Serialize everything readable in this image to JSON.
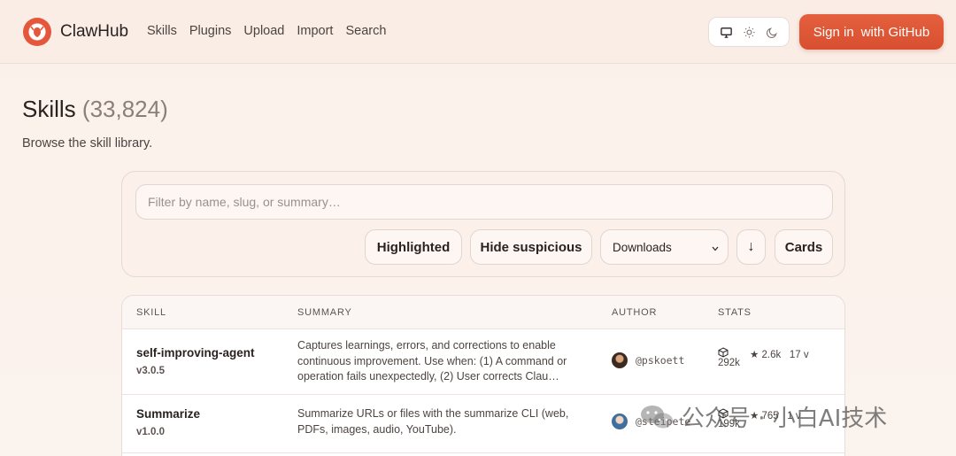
{
  "header": {
    "brand": "ClawHub",
    "nav": [
      "Skills",
      "Plugins",
      "Upload",
      "Import",
      "Search"
    ],
    "theme_icons": [
      "monitor-icon",
      "sun-icon",
      "moon-icon"
    ],
    "signin_label": "Sign in",
    "signin_suffix": "with GitHub",
    "accent_color": "#dd5535"
  },
  "page": {
    "title": "Skills",
    "count": "(33,824)",
    "subtitle": "Browse the skill library."
  },
  "filters": {
    "placeholder": "Filter by name, slug, or summary…",
    "highlighted": "Highlighted",
    "hide_suspicious": "Hide suspicious",
    "sort": "Downloads",
    "sort_direction": "↓",
    "view": "Cards"
  },
  "table": {
    "headers": [
      "SKILL",
      "SUMMARY",
      "AUTHOR",
      "STATS"
    ],
    "rows": [
      {
        "name": "self-improving-agent",
        "version": "v3.0.5",
        "summary": "Captures learnings, errors, and corrections to enable continuous improvement. Use when: (1) A command or operation fails unexpectedly, (2) User corrects Clau…",
        "author": "@pskoett",
        "downloads": "292k",
        "stars": "★ 2.6k",
        "versions": "17 v"
      },
      {
        "name": "Summarize",
        "version": "v1.0.0",
        "summary": "Summarize URLs or files with the summarize CLI (web, PDFs, images, audio, YouTube).",
        "author": "@steipete",
        "downloads": "199k",
        "stars": "★ 765",
        "versions": "1 v"
      }
    ]
  },
  "watermark": "公众号 · 小白AI技术"
}
